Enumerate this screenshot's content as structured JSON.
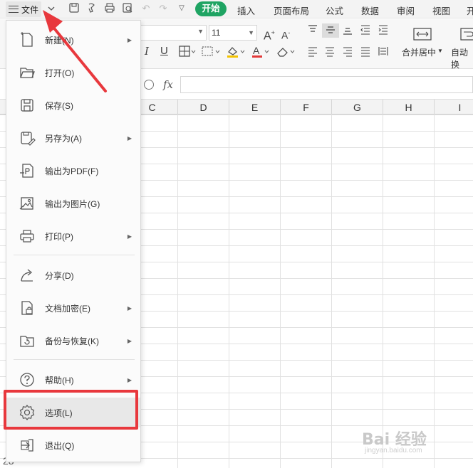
{
  "toolbar": {
    "file_label": "文件",
    "tabs": [
      "插入",
      "页面布局",
      "公式",
      "数据",
      "审阅",
      "视图",
      "开"
    ],
    "active_tab": "开始"
  },
  "ribbon": {
    "font_size": "11",
    "merge_label": "合并居中",
    "auto_label": "自动换"
  },
  "formula_bar": {
    "fx_label": "fx"
  },
  "columns": [
    "C",
    "D",
    "E",
    "F",
    "G",
    "H",
    "I"
  ],
  "row_partial": "28",
  "file_menu": {
    "items": [
      {
        "label": "新建(N)",
        "icon": "new-file-icon",
        "submenu": true
      },
      {
        "label": "打开(O)",
        "icon": "folder-open-icon",
        "submenu": false
      },
      {
        "label": "保存(S)",
        "icon": "save-icon",
        "submenu": false
      },
      {
        "label": "另存为(A)",
        "icon": "save-as-icon",
        "submenu": true
      },
      {
        "label": "输出为PDF(F)",
        "icon": "export-pdf-icon",
        "submenu": false
      },
      {
        "label": "输出为图片(G)",
        "icon": "export-image-icon",
        "submenu": false
      },
      {
        "label": "打印(P)",
        "icon": "print-icon",
        "submenu": true
      },
      {
        "label": "分享(D)",
        "icon": "share-icon",
        "submenu": false
      },
      {
        "label": "文档加密(E)",
        "icon": "lock-document-icon",
        "submenu": true
      },
      {
        "label": "备份与恢复(K)",
        "icon": "backup-icon",
        "submenu": true
      },
      {
        "label": "帮助(H)",
        "icon": "help-icon",
        "submenu": true
      },
      {
        "label": "选项(L)",
        "icon": "gear-icon",
        "submenu": false
      },
      {
        "label": "退出(Q)",
        "icon": "exit-icon",
        "submenu": false
      }
    ]
  },
  "watermark": {
    "brand": "Bai 经验",
    "url": "jingyan.baidu.com"
  },
  "colors": {
    "accent_green": "#1fa463",
    "highlight_red": "#e8383d"
  }
}
